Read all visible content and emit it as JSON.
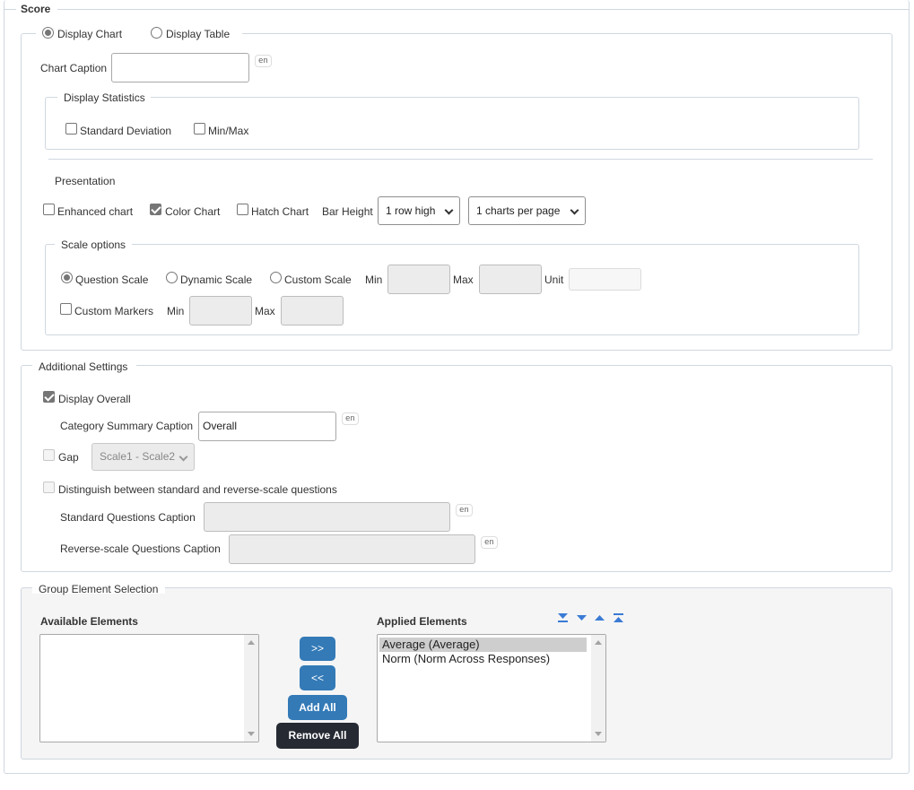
{
  "score": {
    "legend": "Score",
    "display_chart_label": "Display Chart",
    "display_table_label": "Display Table",
    "chart_caption_label": "Chart Caption",
    "chart_caption_value": "",
    "lang_tag": "en",
    "display_statistics": {
      "legend": "Display Statistics",
      "std_dev_label": "Standard Deviation",
      "minmax_label": "Min/Max"
    },
    "presentation": {
      "label": "Presentation",
      "enhanced_label": "Enhanced chart",
      "color_label": "Color Chart",
      "hatch_label": "Hatch Chart",
      "bar_height_label": "Bar Height",
      "bar_height_value": "1 row high",
      "charts_per_page_value": "1 charts per page"
    },
    "scale_options": {
      "legend": "Scale options",
      "question_scale_label": "Question Scale",
      "dynamic_scale_label": "Dynamic Scale",
      "custom_scale_label": "Custom Scale",
      "min_label": "Min",
      "max_label": "Max",
      "unit_label": "Unit",
      "custom_markers_label": "Custom Markers",
      "markers_min_label": "Min",
      "markers_max_label": "Max"
    }
  },
  "additional": {
    "legend": "Additional Settings",
    "display_overall_label": "Display Overall",
    "category_summary_label": "Category Summary Caption",
    "category_summary_value": "Overall",
    "gap_label": "Gap",
    "gap_select_value": "Scale1 - Scale2",
    "distinguish_label": "Distinguish between standard and reverse-scale questions",
    "standard_caption_label": "Standard Questions Caption",
    "reverse_caption_label": "Reverse-scale Questions Caption"
  },
  "group": {
    "legend": "Group Element Selection",
    "available_label": "Available Elements",
    "applied_label": "Applied Elements",
    "add_btn": ">>",
    "remove_btn": "<<",
    "add_all_btn": "Add All",
    "remove_all_btn": "Remove All",
    "applied_items": [
      "Average (Average)",
      "Norm (Norm Across Responses)"
    ]
  },
  "colors": {
    "button_blue": "#337ab7",
    "button_dark": "#262a33",
    "border": "#cfd7df"
  }
}
